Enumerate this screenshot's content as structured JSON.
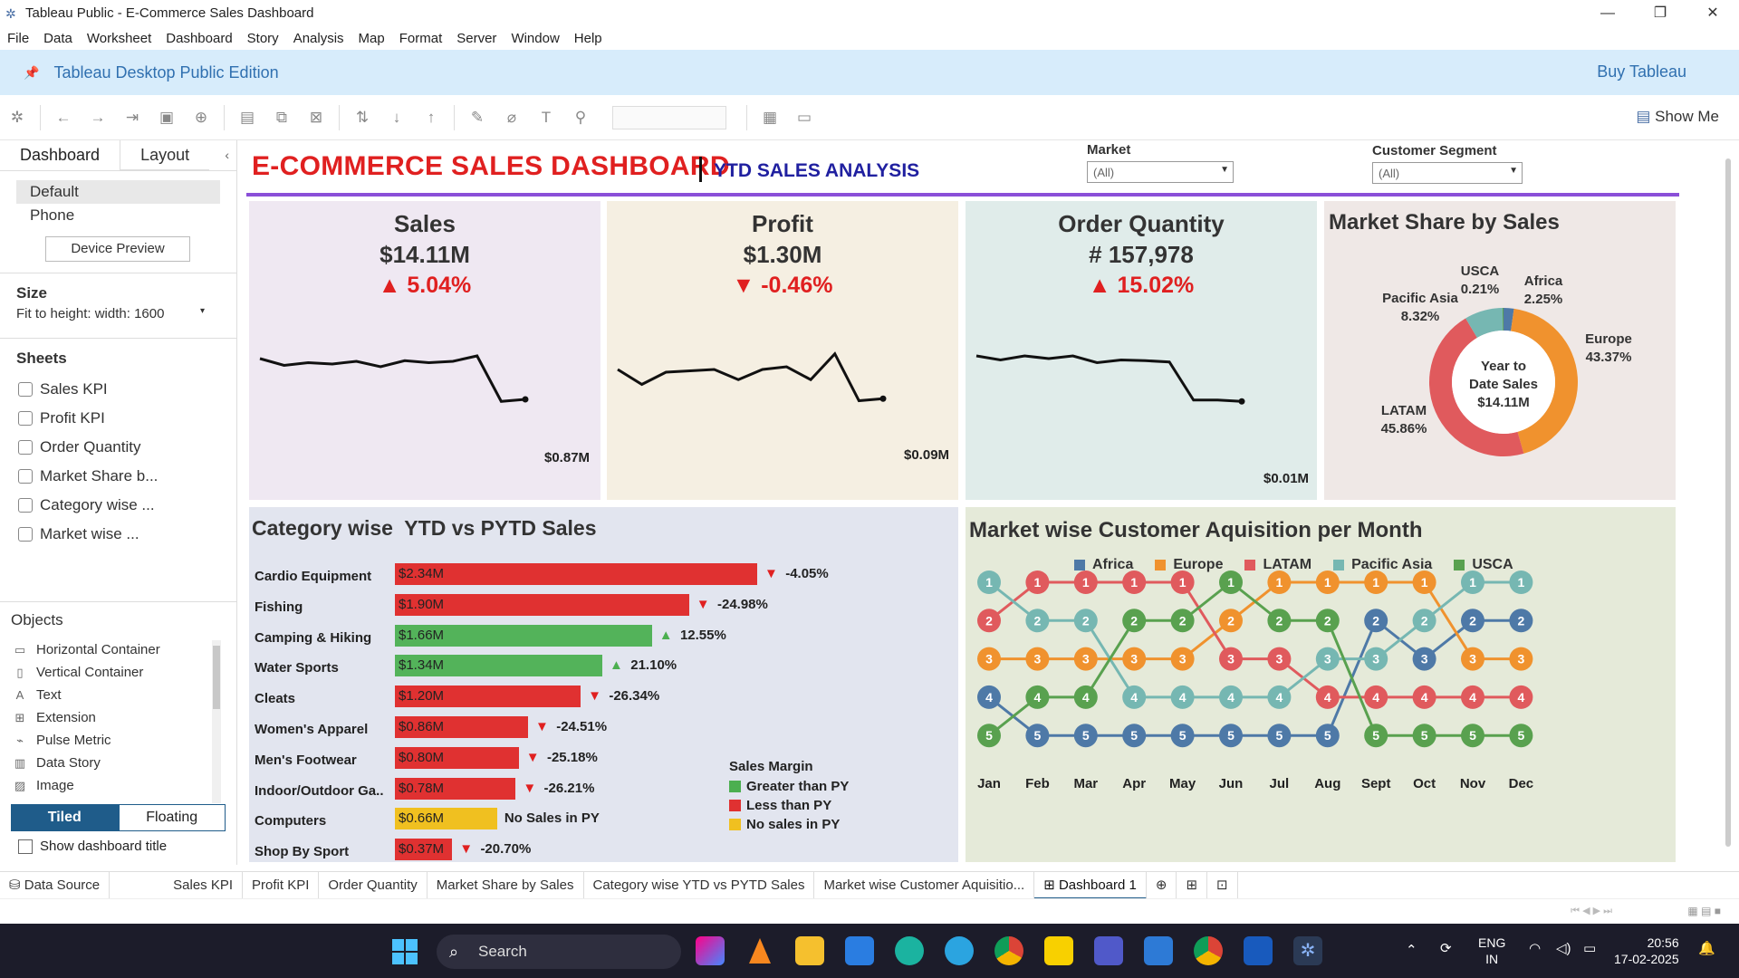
{
  "window": {
    "title": "Tableau Public - E-Commerce Sales Dashboard",
    "controls": [
      "—",
      "❐",
      "✕"
    ]
  },
  "menu": [
    "File",
    "Data",
    "Worksheet",
    "Dashboard",
    "Story",
    "Analysis",
    "Map",
    "Format",
    "Server",
    "Window",
    "Help"
  ],
  "banner": {
    "edition": "Tableau Desktop Public Edition",
    "buy": "Buy Tableau"
  },
  "toolbar": {
    "show_me": "Show Me"
  },
  "side": {
    "tabs": [
      "Dashboard",
      "Layout"
    ],
    "devices": [
      "Default",
      "Phone"
    ],
    "device_preview": "Device Preview",
    "size_header": "Size",
    "size_value": "Fit to height: width: 1600",
    "sheets_header": "Sheets",
    "sheets": [
      "Sales KPI",
      "Profit KPI",
      "Order Quantity",
      "Market Share b...",
      "Category wise ...",
      "Market wise ..."
    ],
    "objects_header": "Objects",
    "objects": [
      "Horizontal Container",
      "Vertical Container",
      "Text",
      "Extension",
      "Pulse Metric",
      "Data Story",
      "Image"
    ],
    "tiled": "Tiled",
    "floating": "Floating",
    "show_title": "Show dashboard title"
  },
  "dashboard": {
    "title": "E-COMMERCE SALES DASHBOARD",
    "subtitle": "YTD SALES ANALYSIS",
    "filters": [
      {
        "label": "Market",
        "value": "(All)"
      },
      {
        "label": "Customer Segment",
        "value": "(All)"
      }
    ],
    "kpis": [
      {
        "title": "Sales",
        "value": "$14.11M",
        "change": "▲ 5.04%",
        "end_label": "$0.87M",
        "bg": "#efe8f2",
        "trend": [
          0.68,
          0.58,
          0.62,
          0.6,
          0.64,
          0.56,
          0.65,
          0.62,
          0.64,
          0.72,
          0.05,
          0.08
        ]
      },
      {
        "title": "Profit",
        "value": "$1.30M",
        "change": "▼ -0.46%",
        "end_label": "$0.09M",
        "bg": "#f5efe2",
        "trend": [
          0.52,
          0.3,
          0.48,
          0.5,
          0.52,
          0.37,
          0.52,
          0.56,
          0.37,
          0.75,
          0.06,
          0.09
        ]
      },
      {
        "title": "Order Quantity",
        "value": "# 157,978",
        "change": "▲ 15.02%",
        "end_label": "$0.01M",
        "bg": "#e0ecea",
        "trend": [
          0.72,
          0.66,
          0.72,
          0.68,
          0.72,
          0.62,
          0.66,
          0.65,
          0.63,
          0.07,
          0.07,
          0.05
        ]
      }
    ],
    "market_share": {
      "title": "Market Share by Sales",
      "center": [
        "Year to",
        "Date Sales",
        "$14.11M"
      ],
      "slices": [
        {
          "name": "Europe",
          "pct": "43.37%",
          "value": 43.37,
          "color": "#f0922e"
        },
        {
          "name": "LATAM",
          "pct": "45.86%",
          "value": 45.86,
          "color": "#e05a5d"
        },
        {
          "name": "Pacific Asia",
          "pct": "8.32%",
          "value": 8.32,
          "color": "#76b7b2"
        },
        {
          "name": "USCA",
          "pct": "0.21%",
          "value": 0.21,
          "color": "#59a14f"
        },
        {
          "name": "Africa",
          "pct": "2.25%",
          "value": 2.25,
          "color": "#4e79a7"
        }
      ]
    },
    "category": {
      "title": "Category wise  YTD vs PYTD Sales",
      "rows": [
        {
          "cat": "Cardio Equipment",
          "value": 2.34,
          "label": "$2.34M",
          "status": "down",
          "chg": "-4.05%"
        },
        {
          "cat": "Fishing",
          "value": 1.9,
          "label": "$1.90M",
          "status": "down",
          "chg": "-24.98%"
        },
        {
          "cat": "Camping & Hiking",
          "value": 1.66,
          "label": "$1.66M",
          "status": "up",
          "chg": "12.55%"
        },
        {
          "cat": "Water Sports",
          "value": 1.34,
          "label": "$1.34M",
          "status": "up",
          "chg": "21.10%"
        },
        {
          "cat": "Cleats",
          "value": 1.2,
          "label": "$1.20M",
          "status": "down",
          "chg": "-26.34%"
        },
        {
          "cat": "Women's Apparel",
          "value": 0.86,
          "label": "$0.86M",
          "status": "down",
          "chg": "-24.51%"
        },
        {
          "cat": "Men's Footwear",
          "value": 0.8,
          "label": "$0.80M",
          "status": "down",
          "chg": "-25.18%"
        },
        {
          "cat": "Indoor/Outdoor Ga..",
          "value": 0.78,
          "label": "$0.78M",
          "status": "down",
          "chg": "-26.21%"
        },
        {
          "cat": "Computers",
          "value": 0.66,
          "label": "$0.66M",
          "status": "none",
          "chg": "No Sales in PY"
        },
        {
          "cat": "Shop By Sport",
          "value": 0.37,
          "label": "$0.37M",
          "status": "down",
          "chg": "-20.70%"
        }
      ],
      "legend_title": "Sales Margin",
      "legend": [
        {
          "label": "Greater than PY",
          "color": "#4caf50"
        },
        {
          "label": "Less than PY",
          "color": "#e03131"
        },
        {
          "label": "No sales in PY",
          "color": "#f0c020"
        }
      ],
      "colors": {
        "up": "#53b35a",
        "down": "#e03131",
        "none": "#f0c020"
      }
    },
    "acquisition": {
      "title": "Market wise Customer Aquisition per Month",
      "months": [
        "Jan",
        "Feb",
        "Mar",
        "Apr",
        "May",
        "Jun",
        "Jul",
        "Aug",
        "Sept",
        "Oct",
        "Nov",
        "Dec"
      ],
      "series": [
        {
          "name": "Africa",
          "color": "#4e79a7",
          "ranks": [
            4,
            5,
            5,
            5,
            5,
            5,
            5,
            5,
            2,
            3,
            2,
            2
          ]
        },
        {
          "name": "Europe",
          "color": "#f0922e",
          "ranks": [
            3,
            3,
            3,
            3,
            3,
            2,
            1,
            1,
            1,
            1,
            3,
            3
          ]
        },
        {
          "name": "LATAM",
          "color": "#e05a5d",
          "ranks": [
            2,
            1,
            1,
            1,
            1,
            3,
            3,
            4,
            4,
            4,
            4,
            4
          ]
        },
        {
          "name": "Pacific Asia",
          "color": "#76b7b2",
          "ranks": [
            1,
            2,
            2,
            4,
            4,
            4,
            4,
            3,
            3,
            2,
            1,
            1
          ]
        },
        {
          "name": "USCA",
          "color": "#59a14f",
          "ranks": [
            5,
            4,
            4,
            2,
            2,
            1,
            2,
            2,
            5,
            5,
            5,
            5
          ]
        }
      ]
    }
  },
  "sheet_tabs": [
    "Data Source",
    "Sales KPI",
    "Profit KPI",
    "Order Quantity",
    "Market Share by Sales",
    "Category wise  YTD vs PYTD Sales",
    "Market wise Customer Aquisitio...",
    "Dashboard 1"
  ],
  "taskbar": {
    "search": "Search",
    "lang": "ENG",
    "region": "IN",
    "time": "20:56",
    "date": "17-02-2025"
  }
}
